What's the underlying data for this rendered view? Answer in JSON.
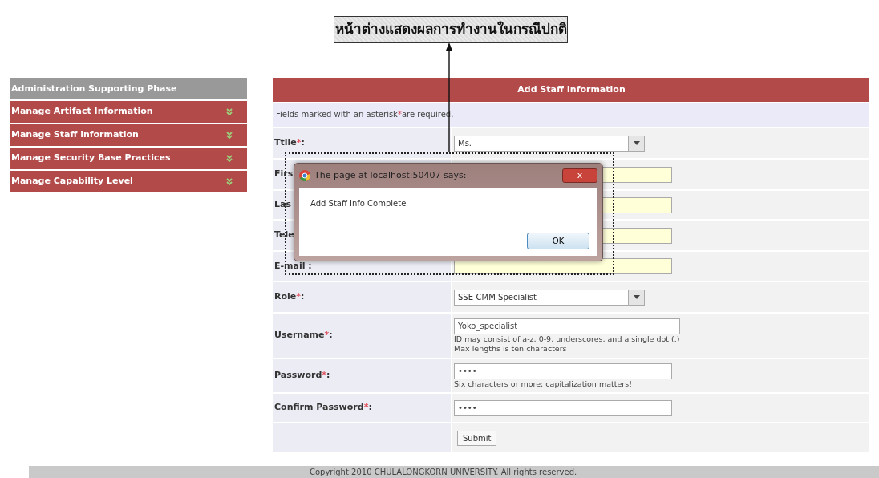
{
  "callout": {
    "text": "หน้าต่างแสดงผลการทำงานในกรณีปกติ"
  },
  "sidebar": {
    "header": "Administration Supporting Phase",
    "items": [
      {
        "label": "Manage Artifact Information"
      },
      {
        "label": "Manage Staff information"
      },
      {
        "label": "Manage Security Base Practices"
      },
      {
        "label": "Manage Capability Level"
      }
    ]
  },
  "form": {
    "title": "Add Staff Information",
    "note": {
      "before": "Fields marked with an asterisk",
      "mark": "*",
      "after": "are required."
    },
    "rows": [
      {
        "label": "Ttile",
        "mark": "*",
        "colon": ":",
        "kind": "select",
        "value": "Ms."
      },
      {
        "label": "Firs",
        "kind": "text"
      },
      {
        "label": "Las",
        "kind": "text"
      },
      {
        "label": "Tele",
        "kind": "text"
      },
      {
        "label": "E-mail :",
        "kind": "text"
      },
      {
        "label": "Role",
        "mark": "*",
        "colon": ":",
        "kind": "select",
        "value": "SSE-CMM Specialist"
      },
      {
        "label": "Username",
        "mark": "*",
        "colon": ":",
        "kind": "plain",
        "value": "Yoko_specialist",
        "hints": [
          "ID may consist of a-z, 0-9, underscores, and a single dot (.)",
          "Max lengths is ten characters"
        ]
      },
      {
        "label": "Password",
        "mark": "*",
        "colon": ":",
        "kind": "password",
        "value": "••••",
        "hints": [
          "Six characters or more; capitalization matters!"
        ]
      },
      {
        "label": "Confirm Password",
        "mark": "*",
        "colon": ":",
        "kind": "password",
        "value": "••••"
      },
      {
        "kind": "submit",
        "value": "Submit"
      }
    ]
  },
  "dialog": {
    "title": "The page at localhost:50407 says:",
    "close": "x",
    "message": "Add Staff Info Complete",
    "ok": "OK"
  },
  "footer": {
    "text": "Copyright 2010 CHULALONGKORN UNIVERSITY. All rights reserved."
  }
}
